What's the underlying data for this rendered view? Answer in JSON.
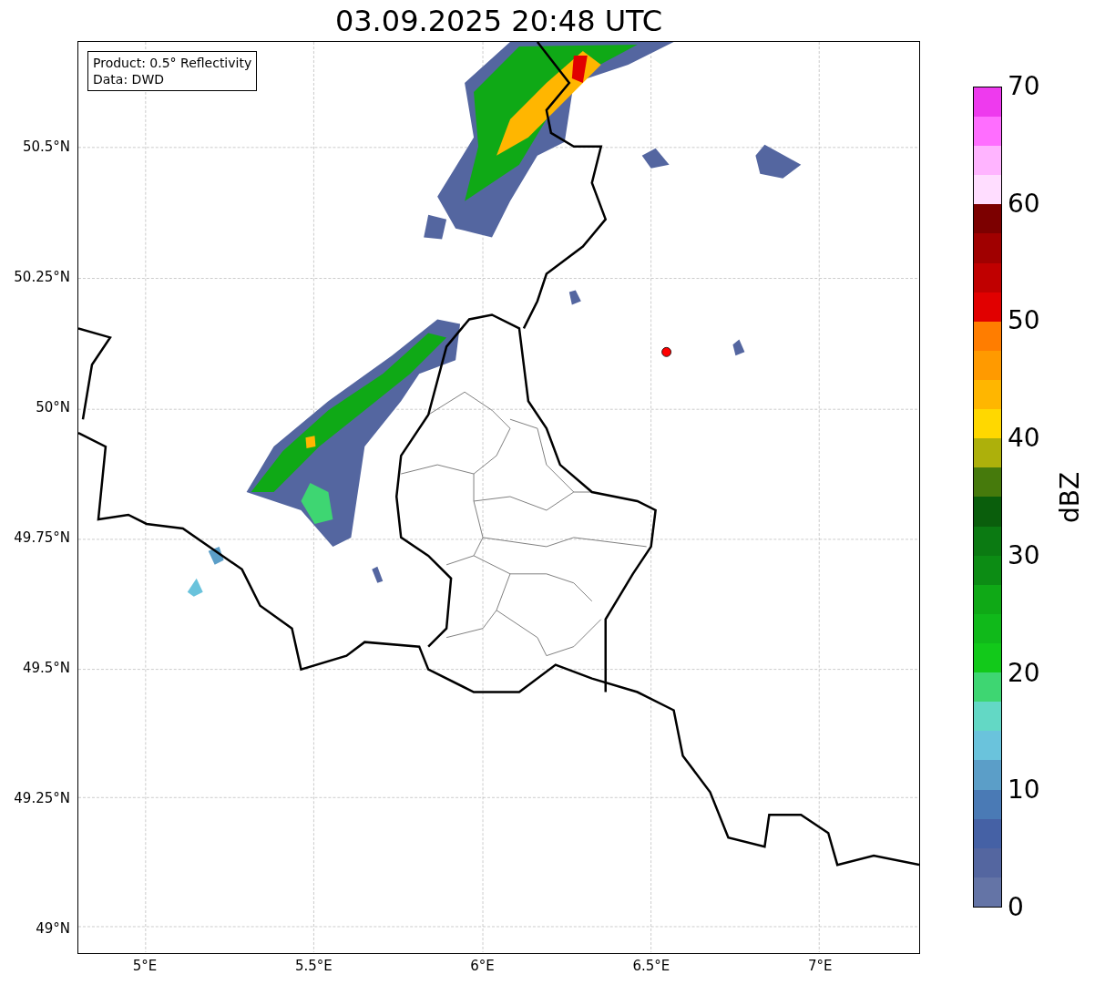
{
  "title": "03.09.2025 20:48 UTC",
  "legend": [
    "Product: 0.5° Reflectivity",
    "Data: DWD"
  ],
  "y_ticks": [
    "50.5°N",
    "50.25°N",
    "50°N",
    "49.75°N",
    "49.5°N",
    "49.25°N",
    "49°N"
  ],
  "x_ticks": [
    "5°E",
    "5.5°E",
    "6°E",
    "6.5°E",
    "7°E"
  ],
  "colorbar": {
    "label": "dBZ",
    "ticks": [
      "70",
      "60",
      "50",
      "40",
      "30",
      "20",
      "10",
      "0"
    ],
    "segments": [
      {
        "color": "#6474a6"
      },
      {
        "color": "#5466a0"
      },
      {
        "color": "#4561a5"
      },
      {
        "color": "#4a7ab5"
      },
      {
        "color": "#5b9ec8"
      },
      {
        "color": "#6ac3dc"
      },
      {
        "color": "#63d8c5"
      },
      {
        "color": "#3ed672"
      },
      {
        "color": "#12c91a"
      },
      {
        "color": "#10b91a"
      },
      {
        "color": "#0fa916"
      },
      {
        "color": "#0c8c14"
      },
      {
        "color": "#0b7a12"
      },
      {
        "color": "#0a5e0c"
      },
      {
        "color": "#467a0c"
      },
      {
        "color": "#adb00b"
      },
      {
        "color": "#ffd800"
      },
      {
        "color": "#ffb600"
      },
      {
        "color": "#ff9a00"
      },
      {
        "color": "#ff7d00"
      },
      {
        "color": "#e10000"
      },
      {
        "color": "#c00000"
      },
      {
        "color": "#a00000"
      },
      {
        "color": "#7c0000"
      },
      {
        "color": "#ffddff"
      },
      {
        "color": "#ffb4ff"
      },
      {
        "color": "#ff6eff"
      },
      {
        "color": "#ee3aee"
      }
    ]
  }
}
